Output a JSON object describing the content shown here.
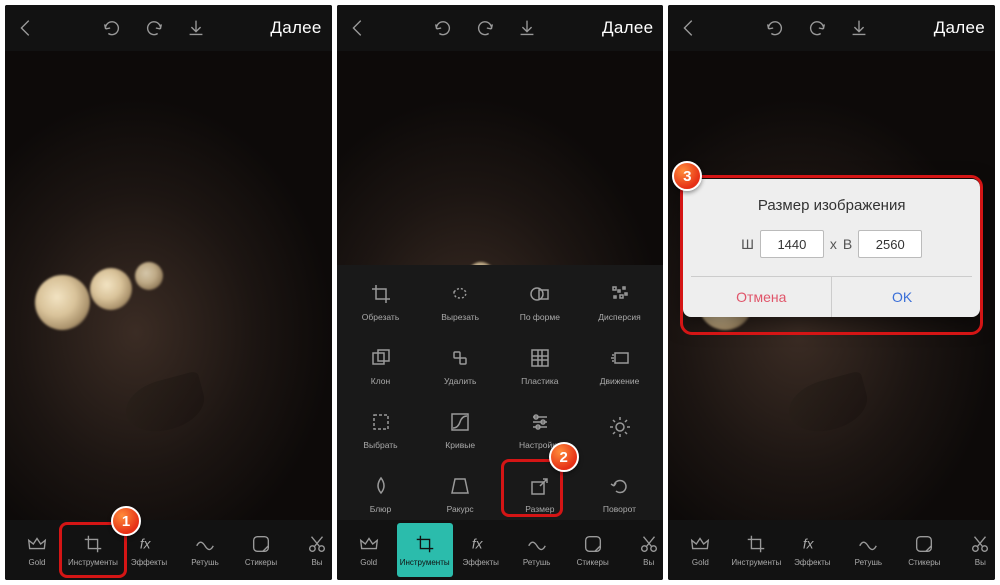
{
  "topbar": {
    "next": "Далее"
  },
  "bottom_items": [
    {
      "label": "Gold",
      "icon": "crown"
    },
    {
      "label": "Инструменты",
      "icon": "crop"
    },
    {
      "label": "Эффекты",
      "icon": "fx"
    },
    {
      "label": "Ретушь",
      "icon": "retouch"
    },
    {
      "label": "Стикеры",
      "icon": "sticker"
    },
    {
      "label": "Вы",
      "icon": "cut"
    }
  ],
  "active_bottom_index_s2": 1,
  "tools_grid": [
    {
      "label": "Обрезать",
      "icon": "crop"
    },
    {
      "label": "Вырезать",
      "icon": "lasso"
    },
    {
      "label": "По форме",
      "icon": "shape"
    },
    {
      "label": "Дисперсия",
      "icon": "dispersion"
    },
    {
      "label": "Клон",
      "icon": "clone"
    },
    {
      "label": "Удалить",
      "icon": "eraser",
      "color": true
    },
    {
      "label": "Пластика",
      "icon": "mesh"
    },
    {
      "label": "Движение",
      "icon": "motion"
    },
    {
      "label": "Выбрать",
      "icon": "select"
    },
    {
      "label": "Кривые",
      "icon": "curves"
    },
    {
      "label": "Настройки",
      "icon": "tune"
    },
    {
      "label": "",
      "icon": "enhance"
    },
    {
      "label": "Блюр",
      "icon": "blur"
    },
    {
      "label": "Ракурс",
      "icon": "perspective"
    },
    {
      "label": "Размер",
      "icon": "resize"
    },
    {
      "label": "Поворот",
      "icon": "rotate"
    }
  ],
  "dialog": {
    "title": "Размер изображения",
    "w_label": "Ш",
    "w_value": "1440",
    "x": "x",
    "h_label": "В",
    "h_value": "2560",
    "cancel": "Отмена",
    "ok": "OK"
  },
  "callouts": {
    "s1": "1",
    "s2": "2",
    "s3": "3"
  }
}
